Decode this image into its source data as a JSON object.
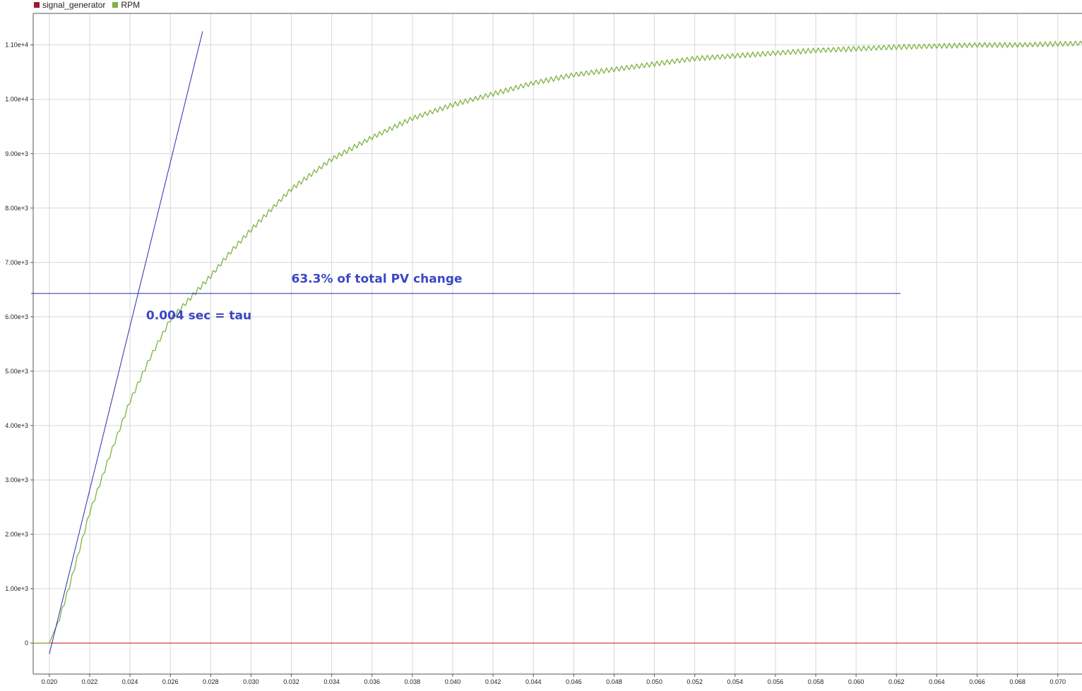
{
  "colors": {
    "signal_generator": "#9b1b30",
    "rpm": "#7cb342",
    "annotation": "#2b2bb5",
    "annotation_text": "#3a47c4",
    "grid": "#d7d7d7",
    "baseline": "#d04050"
  },
  "legend": {
    "items": [
      {
        "label": "signal_generator",
        "color": "#9b1b30"
      },
      {
        "label": "RPM",
        "color": "#7cb342"
      }
    ]
  },
  "annotations": {
    "pv_change_label": "63.3% of total PV change",
    "tau_label": "0.004 sec = tau"
  },
  "chart_data": {
    "type": "line",
    "title": "",
    "xlabel": "",
    "ylabel": "",
    "xlim": [
      0.0192,
      0.0712
    ],
    "ylim": [
      -570,
      11580
    ],
    "x_ticks": [
      0.02,
      0.022,
      0.024,
      0.026,
      0.028,
      0.03,
      0.032,
      0.034,
      0.036,
      0.038,
      0.04,
      0.042,
      0.044,
      0.046,
      0.048,
      0.05,
      0.052,
      0.054,
      0.056,
      0.058,
      0.06,
      0.062,
      0.064,
      0.066,
      0.068,
      0.07
    ],
    "x_tick_labels": [
      "0.020",
      "0.022",
      "0.024",
      "0.026",
      "0.028",
      "0.030",
      "0.032",
      "0.034",
      "0.036",
      "0.038",
      "0.040",
      "0.042",
      "0.044",
      "0.046",
      "0.048",
      "0.050",
      "0.052",
      "0.054",
      "0.056",
      "0.058",
      "0.060",
      "0.062",
      "0.064",
      "0.066",
      "0.068",
      "0.070"
    ],
    "y_ticks": [
      0,
      1000,
      2000,
      3000,
      4000,
      5000,
      6000,
      7000,
      8000,
      9000,
      10000,
      11000
    ],
    "y_tick_labels": [
      "0",
      "1.00e+3",
      "2.00e+3",
      "3.00e+3",
      "4.00e+3",
      "5.00e+3",
      "6.00e+3",
      "7.00e+3",
      "8.00e+3",
      "9.00e+3",
      "1.00e+4",
      "1.10e+4"
    ],
    "grid": true,
    "legend_position": "top-left",
    "series": [
      {
        "name": "signal_generator",
        "x": [
          0.0192,
          0.0712
        ],
        "y": [
          0,
          0
        ]
      },
      {
        "name": "RPM",
        "x": [
          0.0192,
          0.02,
          0.0205,
          0.021,
          0.022,
          0.023,
          0.024,
          0.025,
          0.026,
          0.027,
          0.028,
          0.029,
          0.03,
          0.032,
          0.034,
          0.036,
          0.038,
          0.04,
          0.042,
          0.044,
          0.046,
          0.048,
          0.05,
          0.052,
          0.054,
          0.056,
          0.058,
          0.06,
          0.062,
          0.064,
          0.066,
          0.068,
          0.07,
          0.0712
        ],
        "y": [
          0,
          0,
          450,
          1050,
          2400,
          3450,
          4450,
          5250,
          5950,
          6350,
          6750,
          7200,
          7600,
          8350,
          8900,
          9300,
          9650,
          9900,
          10100,
          10300,
          10450,
          10550,
          10650,
          10750,
          10800,
          10850,
          10900,
          10930,
          10960,
          10980,
          11000,
          11000,
          11020,
          11030
        ]
      }
    ],
    "annotation_lines": [
      {
        "type": "tangent",
        "x": [
          0.02,
          0.0276
        ],
        "y": [
          -200,
          11250
        ]
      },
      {
        "type": "horizontal",
        "x": [
          0.0191,
          0.0622
        ],
        "y": [
          6430,
          6430
        ]
      }
    ],
    "annotation_text": [
      {
        "text": "63.3% of total PV change",
        "x": 0.032,
        "y": 6630
      },
      {
        "text": "0.004 sec = tau",
        "x": 0.0248,
        "y": 5950
      }
    ]
  }
}
